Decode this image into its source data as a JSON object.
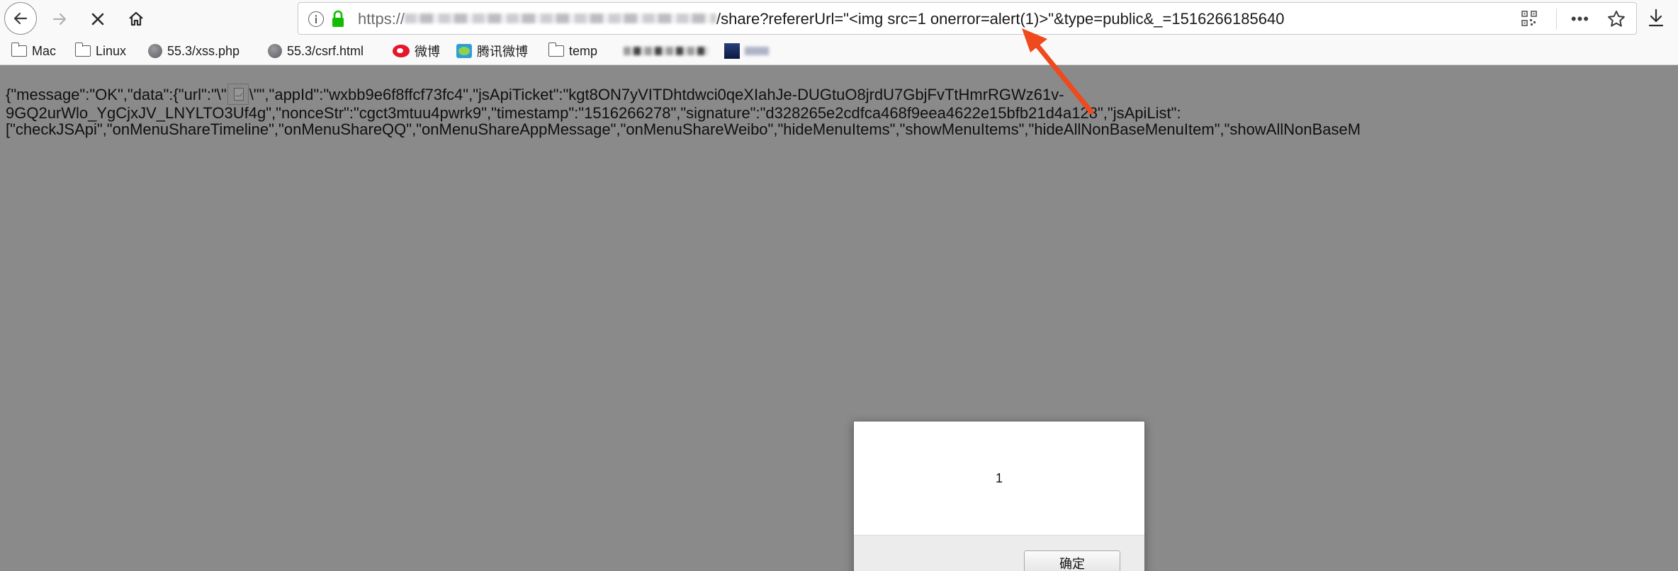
{
  "browser": {
    "url": {
      "scheme": "https://",
      "path": "/share?refererUrl=\"<img src=1 onerror=alert(1)>\"&type=public&_=1516266185640"
    }
  },
  "bookmarks": [
    {
      "label": "Mac",
      "icon": "folder-icon"
    },
    {
      "label": "Linux",
      "icon": "folder-icon"
    },
    {
      "label": "55.3/xss.php",
      "icon": "globe-icon"
    },
    {
      "label": "55.3/csrf.html",
      "icon": "globe-icon"
    },
    {
      "label": "微博",
      "icon": "weibo-icon"
    },
    {
      "label": "腾讯微博",
      "icon": "tencent-weibo-icon"
    },
    {
      "label": "temp",
      "icon": "folder-icon"
    }
  ],
  "page": {
    "json_line1_a": "{\"message\":\"OK\",\"data\":{\"url\":\"\\\"",
    "json_line1_b": "\\\"\",\"appId\":\"wxbb9e6f8ffcf73fc4\",\"jsApiTicket\":\"kgt8ON7yVITDhtdwci0qeXIahJe-DUGtuO8jrdU7GbjFvTtHmrRGWz61v-",
    "json_line2": "9GQ2urWlo_YgCjxJV_LNYLTO3Uf4g\",\"nonceStr\":\"cgct3mtuu4pwrk9\",\"timestamp\":\"1516266278\",\"signature\":\"d328265e2cdfca468f9eea4622e15bfb21d4a128\",\"jsApiList\":",
    "json_line3": "[\"checkJSApi\",\"onMenuShareTimeline\",\"onMenuShareQQ\",\"onMenuShareAppMessage\",\"onMenuShareWeibo\",\"hideMenuItems\",\"showMenuItems\",\"hideAllNonBaseMenuItem\",\"showAllNonBaseM"
  },
  "alert": {
    "message": "1",
    "ok_label": "确定"
  },
  "colors": {
    "annotation_arrow": "#ee4a1e",
    "secure_lock": "#12bc00"
  }
}
